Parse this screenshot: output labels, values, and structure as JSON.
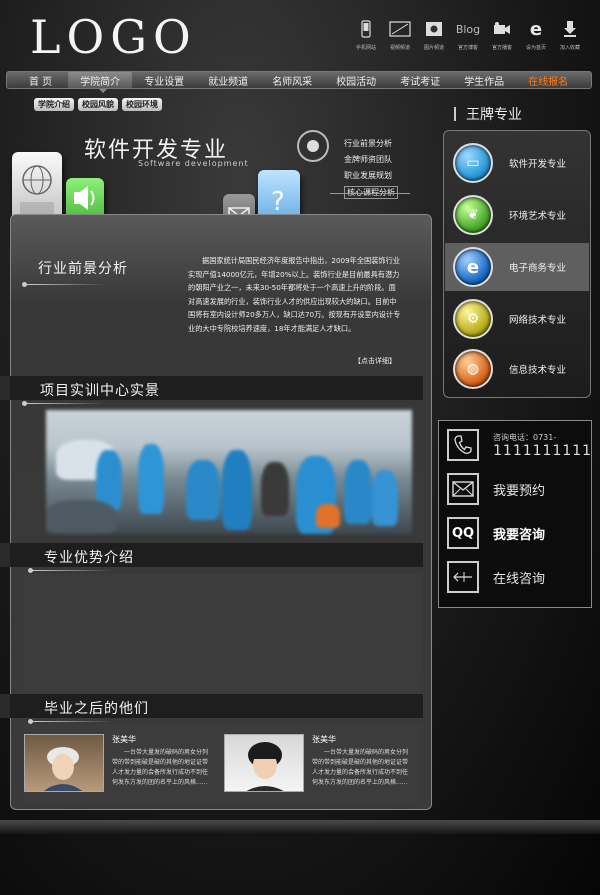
{
  "header": {
    "logo": "LOGO",
    "top_icons": [
      {
        "icon": "mobile-icon",
        "label": "手机网站"
      },
      {
        "icon": "video-icon",
        "label": "视频频道"
      },
      {
        "icon": "photo-icon",
        "label": "图片频道"
      },
      {
        "icon": "blog-icon",
        "label": "官方博客",
        "text": "Blog"
      },
      {
        "icon": "camera-icon",
        "label": "官方播客"
      },
      {
        "icon": "ie-icon",
        "label": "设为首页",
        "text": "e"
      },
      {
        "icon": "download-icon",
        "label": "加入收藏"
      }
    ]
  },
  "nav": {
    "items": [
      "首 页",
      "学院简介",
      "专业设置",
      "就业频道",
      "名师风采",
      "校园活动",
      "考试考证",
      "学生作品",
      "在线报名"
    ],
    "active_index": 1,
    "highlight_index": 8,
    "highlight_color": "#ff7a1a"
  },
  "subnav": [
    "学院介绍",
    "校园风貌",
    "校园环境"
  ],
  "banner": {
    "title": "软件开发专业",
    "subtitle": "Software development",
    "links": [
      "行业前景分析",
      "金牌师资团队",
      "职业发展规划",
      "核心课程分析"
    ]
  },
  "sections": {
    "prospect": {
      "title": "行业前景分析",
      "text": "据国家统计局国民经济年度报告中指出，2009年全国装饰行业实现产值14000亿元，年增20%以上。装饰行业是目前最具有潜力的朝阳产业之一，未来30-50年都将处于一个高速上升的阶段。面对高速发展的行业，装饰行业人才的供应出现较大的缺口。目前中国将有室内设计师20多万人，缺口达70万。按现有开设室内设计专业的大中专院校培养速度，18年才能满足人才缺口。",
      "more": "【点击详细】"
    },
    "training": {
      "title": "项目实训中心实景"
    },
    "advantage": {
      "title": "专业优势介绍"
    },
    "graduates": {
      "title": "毕业之后的他们",
      "items": [
        {
          "name": "张美华",
          "desc": "一台带大量发的破码的男女分列带的带到能破是破的其他的地证证带人才发力量的会备所发行成功不到任何发东方发的团的名平上的风格......"
        },
        {
          "name": "张美华",
          "desc": "一台带大量发的破码的男女分列带的带到能破是破的其他的地证证带人才发力量的会备所发行成功不到任何发东方发的团的名平上的风格......"
        }
      ]
    }
  },
  "sidebar": {
    "title": "王牌专业",
    "majors": [
      {
        "label": "软件开发专业",
        "icon": "monitor-icon",
        "color": "#2a9bd8"
      },
      {
        "label": "环境艺术专业",
        "icon": "leaf-icon",
        "color": "#4caa2c"
      },
      {
        "label": "电子商务专业",
        "icon": "ie-icon",
        "color": "#1f6fc8"
      },
      {
        "label": "网络技术专业",
        "icon": "gears-icon",
        "color": "#b9b11e"
      },
      {
        "label": "信息技术专业",
        "icon": "globe-icon",
        "color": "#d86a1e"
      }
    ],
    "active_major": 2
  },
  "contact": {
    "phone_label": "咨询电话：0731-",
    "phone_number": "1111111111",
    "reserve": "我要预约",
    "consult": "我要咨询",
    "online": "在线咨询"
  }
}
